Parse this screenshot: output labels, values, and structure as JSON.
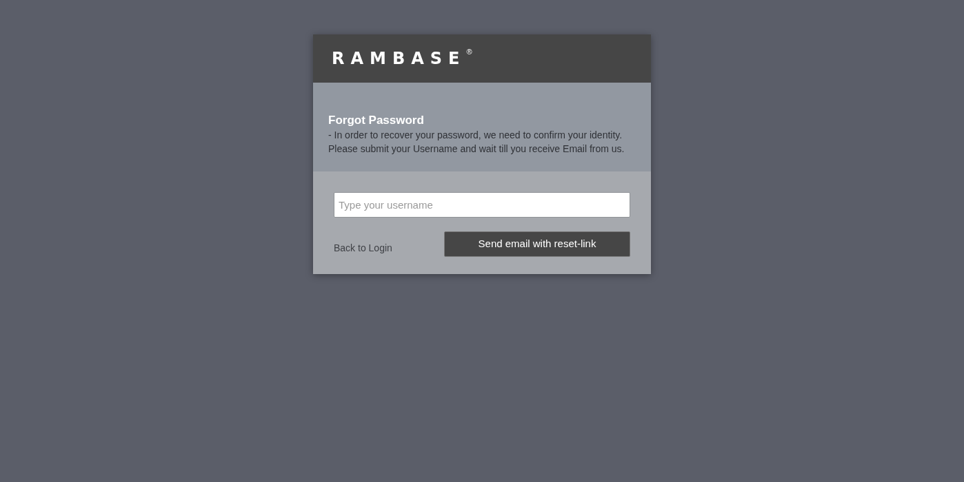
{
  "header": {
    "logo": "RAMBASE",
    "registered_mark": "®"
  },
  "info": {
    "title": "Forgot Password",
    "description": "- In order to recover your password, we need to confirm your identity.\nPlease submit your Username and wait till you receive Email from us."
  },
  "form": {
    "username_field": {
      "placeholder": "Type your username"
    },
    "back_link": "Back to Login",
    "submit_button": "Send email with reset-link"
  }
}
